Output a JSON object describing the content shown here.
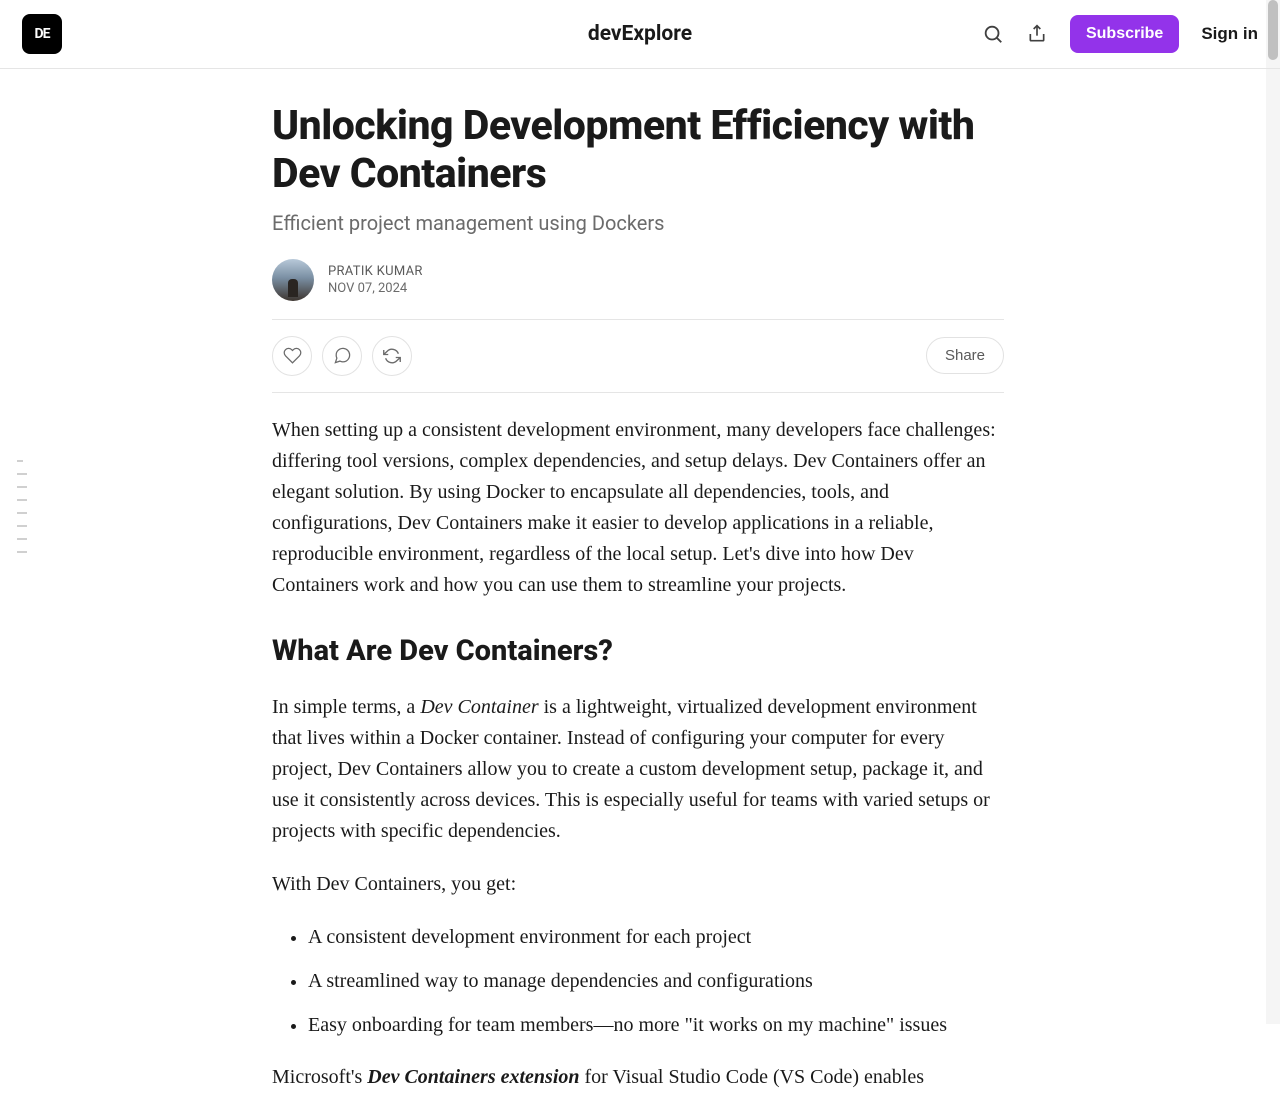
{
  "header": {
    "brand": "devExplore",
    "subscribe": "Subscribe",
    "signin": "Sign in"
  },
  "post": {
    "title": "Unlocking Development Efficiency with Dev Containers",
    "subtitle": "Efficient project management using Dockers",
    "author": "PRATIK KUMAR",
    "date": "NOV 07, 2024",
    "share": "Share"
  },
  "content": {
    "intro": "When setting up a consistent development environment, many developers face challenges: differing tool versions, complex dependencies, and setup delays. Dev Containers offer an elegant solution. By using Docker to encapsulate all dependencies, tools, and configurations, Dev Containers make it easier to develop applications in a reliable, reproducible environment, regardless of the local setup. Let's dive into how Dev Containers work and how you can use them to streamline your projects.",
    "h2_1": "What Are Dev Containers?",
    "p2_pre": "In simple terms, a ",
    "p2_em": "Dev Container",
    "p2_post": " is a lightweight, virtualized development environment that lives within a Docker container. Instead of configuring your computer for every project, Dev Containers allow you to create a custom development setup, package it, and use it consistently across devices. This is especially useful for teams with varied setups or projects with specific dependencies.",
    "p3": "With Dev Containers, you get:",
    "bullets": [
      "A consistent development environment for each project",
      "A streamlined way to manage dependencies and configurations",
      "Easy onboarding for team members—no more \"it works on my machine\" issues"
    ],
    "p4_pre": "Microsoft's ",
    "p4_em": "Dev Containers extension",
    "p4_post": " for Visual Studio Code (VS Code) enables"
  }
}
